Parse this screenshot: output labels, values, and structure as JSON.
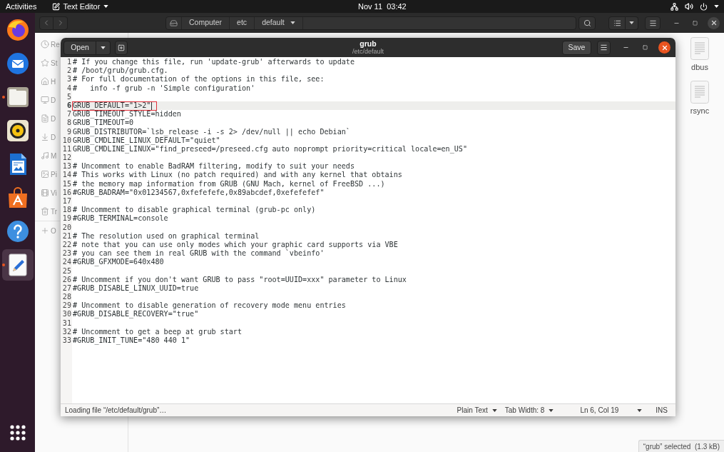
{
  "top_bar": {
    "activities": "Activities",
    "app_menu": "Text Editor",
    "clock": "Nov 11  03:42"
  },
  "dock": {
    "items": [
      {
        "kind": "browser",
        "running": false,
        "selected": false
      },
      {
        "kind": "mail",
        "running": false,
        "selected": false
      },
      {
        "kind": "files",
        "running": true,
        "selected": false
      },
      {
        "kind": "music",
        "running": false,
        "selected": false
      },
      {
        "kind": "writer",
        "running": false,
        "selected": false
      },
      {
        "kind": "store",
        "running": false,
        "selected": false
      },
      {
        "kind": "help",
        "running": false,
        "selected": false
      },
      {
        "kind": "editor",
        "running": true,
        "selected": true
      }
    ]
  },
  "file_manager": {
    "path": [
      {
        "label": "Computer"
      },
      {
        "label": "etc"
      },
      {
        "label": "default"
      }
    ],
    "sidebar": [
      {
        "kind": "recent",
        "label": "Re"
      },
      {
        "kind": "starred",
        "label": "St"
      },
      {
        "kind": "home",
        "label": "H"
      },
      {
        "kind": "desktop",
        "label": "D"
      },
      {
        "kind": "documents",
        "label": "D"
      },
      {
        "kind": "downloads",
        "label": "D"
      },
      {
        "kind": "music",
        "label": "M"
      },
      {
        "kind": "pictures",
        "label": "Pi"
      },
      {
        "kind": "videos",
        "label": "Vi"
      },
      {
        "kind": "trash",
        "label": "Tr"
      },
      {
        "kind": "other",
        "label": "O"
      }
    ],
    "files": [
      {
        "name": "dbus"
      },
      {
        "name": "rsync"
      }
    ],
    "status": "“grub” selected  (1.3 kB)"
  },
  "editor": {
    "open_button": "Open",
    "title": "grub",
    "subtitle": "/etc/default",
    "save_button": "Save",
    "lines": [
      {
        "number": "1",
        "text": "# If you change this file, run 'update-grub' afterwards to update",
        "current": false,
        "marked": false
      },
      {
        "number": "2",
        "text": "# /boot/grub/grub.cfg.",
        "current": false,
        "marked": false
      },
      {
        "number": "3",
        "text": "# For full documentation of the options in this file, see:",
        "current": false,
        "marked": false
      },
      {
        "number": "4",
        "text": "#   info -f grub -n 'Simple configuration'",
        "current": false,
        "marked": false
      },
      {
        "number": "5",
        "current": false,
        "marked": false
      },
      {
        "number": "6",
        "text": "GRUB_DEFAULT=\"1>2\"",
        "current": true,
        "marked": true
      },
      {
        "number": "7",
        "text": "GRUB_TIMEOUT_STYLE=hidden",
        "current": false,
        "marked": false
      },
      {
        "number": "8",
        "text": "GRUB_TIMEOUT=0",
        "current": false,
        "marked": false
      },
      {
        "number": "9",
        "text": "GRUB_DISTRIBUTOR=`lsb_release -i -s 2> /dev/null || echo Debian`",
        "current": false,
        "marked": false
      },
      {
        "number": "10",
        "text": "GRUB_CMDLINE_LINUX_DEFAULT=\"quiet\"",
        "current": false,
        "marked": false
      },
      {
        "number": "11",
        "text": "GRUB_CMDLINE_LINUX=\"find_preseed=/preseed.cfg auto noprompt priority=critical locale=en_US\"",
        "current": false,
        "marked": false
      },
      {
        "number": "12",
        "current": false,
        "marked": false
      },
      {
        "number": "13",
        "text": "# Uncomment to enable BadRAM filtering, modify to suit your needs",
        "current": false,
        "marked": false
      },
      {
        "number": "14",
        "text": "# This works with Linux (no patch required) and with any kernel that obtains",
        "current": false,
        "marked": false
      },
      {
        "number": "15",
        "text": "# the memory map information from GRUB (GNU Mach, kernel of FreeBSD ...)",
        "current": false,
        "marked": false
      },
      {
        "number": "16",
        "text": "#GRUB_BADRAM=\"0x01234567,0xfefefefe,0x89abcdef,0xefefefef\"",
        "current": false,
        "marked": false
      },
      {
        "number": "17",
        "current": false,
        "marked": false
      },
      {
        "number": "18",
        "text": "# Uncomment to disable graphical terminal (grub-pc only)",
        "current": false,
        "marked": false
      },
      {
        "number": "19",
        "text": "#GRUB_TERMINAL=console",
        "current": false,
        "marked": false
      },
      {
        "number": "20",
        "current": false,
        "marked": false
      },
      {
        "number": "21",
        "text": "# The resolution used on graphical terminal",
        "current": false,
        "marked": false
      },
      {
        "number": "22",
        "text": "# note that you can use only modes which your graphic card supports via VBE",
        "current": false,
        "marked": false
      },
      {
        "number": "23",
        "text": "# you can see them in real GRUB with the command `vbeinfo'",
        "current": false,
        "marked": false
      },
      {
        "number": "24",
        "text": "#GRUB_GFXMODE=640x480",
        "current": false,
        "marked": false
      },
      {
        "number": "25",
        "current": false,
        "marked": false
      },
      {
        "number": "26",
        "text": "# Uncomment if you don't want GRUB to pass \"root=UUID=xxx\" parameter to Linux",
        "current": false,
        "marked": false
      },
      {
        "number": "27",
        "text": "#GRUB_DISABLE_LINUX_UUID=true",
        "current": false,
        "marked": false
      },
      {
        "number": "28",
        "current": false,
        "marked": false
      },
      {
        "number": "29",
        "text": "# Uncomment to disable generation of recovery mode menu entries",
        "current": false,
        "marked": false
      },
      {
        "number": "30",
        "text": "#GRUB_DISABLE_RECOVERY=\"true\"",
        "current": false,
        "marked": false
      },
      {
        "number": "31",
        "current": false,
        "marked": false
      },
      {
        "number": "32",
        "text": "# Uncomment to get a beep at grub start",
        "current": false,
        "marked": false
      },
      {
        "number": "33",
        "text": "#GRUB_INIT_TUNE=\"480 440 1\"",
        "current": false,
        "marked": false
      }
    ],
    "status": {
      "message": "Loading file “/etc/default/grub”…",
      "language": "Plain Text",
      "tab_width": "Tab Width: 8",
      "position": "Ln 6, Col 19",
      "mode": "INS"
    }
  }
}
